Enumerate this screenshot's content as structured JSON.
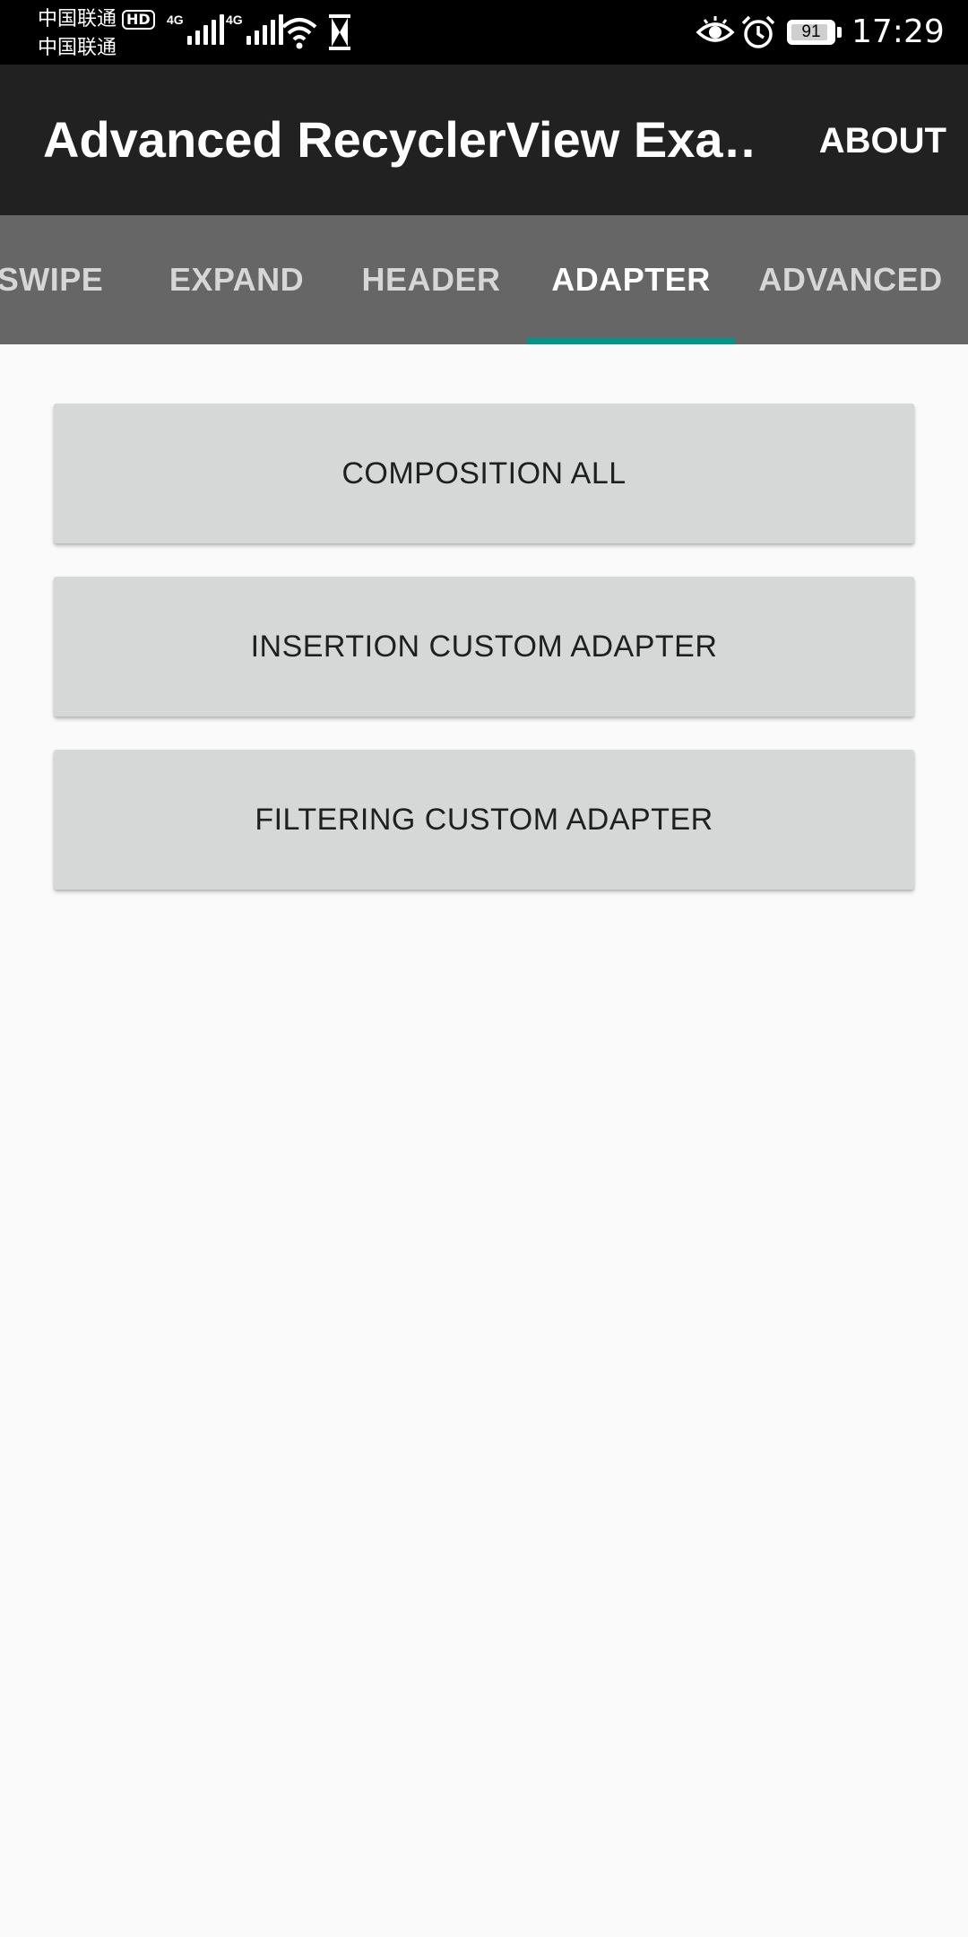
{
  "status_bar": {
    "carrier_1": "中国联通",
    "carrier_2": "中国联通",
    "hd_badge": "HD",
    "network_1": "4G",
    "network_2": "4G",
    "battery_level": "91",
    "time": "17:29",
    "icons": [
      "signal-icon",
      "wifi-icon",
      "hourglass-icon",
      "eye-icon",
      "alarm-icon",
      "battery-icon"
    ]
  },
  "app_bar": {
    "title": "Advanced RecyclerView Exa…",
    "about_label": "ABOUT",
    "background": "#212121"
  },
  "tabs": {
    "items": [
      {
        "label": "SWIPE"
      },
      {
        "label": "EXPAND"
      },
      {
        "label": "HEADER"
      },
      {
        "label": "ADAPTER"
      },
      {
        "label": "ADVANCED"
      }
    ],
    "active": "ADAPTER",
    "indicator_color": "#009688",
    "background": "#666666"
  },
  "buttons": [
    {
      "label": "COMPOSITION ALL"
    },
    {
      "label": "INSERTION CUSTOM ADAPTER"
    },
    {
      "label": "FILTERING CUSTOM ADAPTER"
    }
  ]
}
